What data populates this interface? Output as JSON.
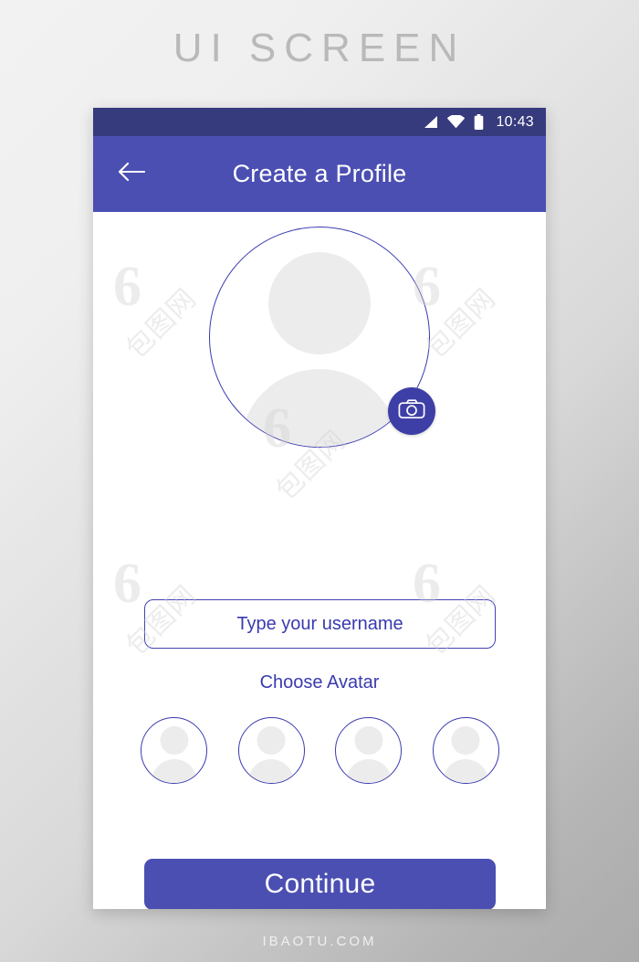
{
  "page": {
    "heading": "UI SCREEN",
    "footer": "IBAOTU.COM"
  },
  "colors": {
    "status_bar": "#363b7d",
    "app_bar": "#4b4fb2",
    "accent": "#3a3ab0",
    "button": "#4b4fb2",
    "silhouette": "#ececec",
    "page_bg_start": "#f2f2f2",
    "page_bg_end": "#ababab"
  },
  "status_bar": {
    "time": "10:43",
    "icons": [
      "signal-icon",
      "wifi-icon",
      "battery-icon"
    ]
  },
  "app_bar": {
    "back_icon": "back-arrow-icon",
    "title": "Create a Profile"
  },
  "profile": {
    "avatar_icon": "person-placeholder-icon",
    "camera_button_icon": "camera-icon"
  },
  "form": {
    "username_value": "",
    "username_placeholder": "Type your username",
    "choose_avatar_label": "Choose Avatar",
    "avatar_options": [
      {
        "name": "avatar-option-1",
        "icon": "person-placeholder-icon"
      },
      {
        "name": "avatar-option-2",
        "icon": "person-placeholder-icon"
      },
      {
        "name": "avatar-option-3",
        "icon": "person-placeholder-icon"
      },
      {
        "name": "avatar-option-4",
        "icon": "person-placeholder-icon"
      }
    ],
    "continue_label": "Continue"
  },
  "watermark": {
    "logo": "6",
    "text": "包图网"
  }
}
